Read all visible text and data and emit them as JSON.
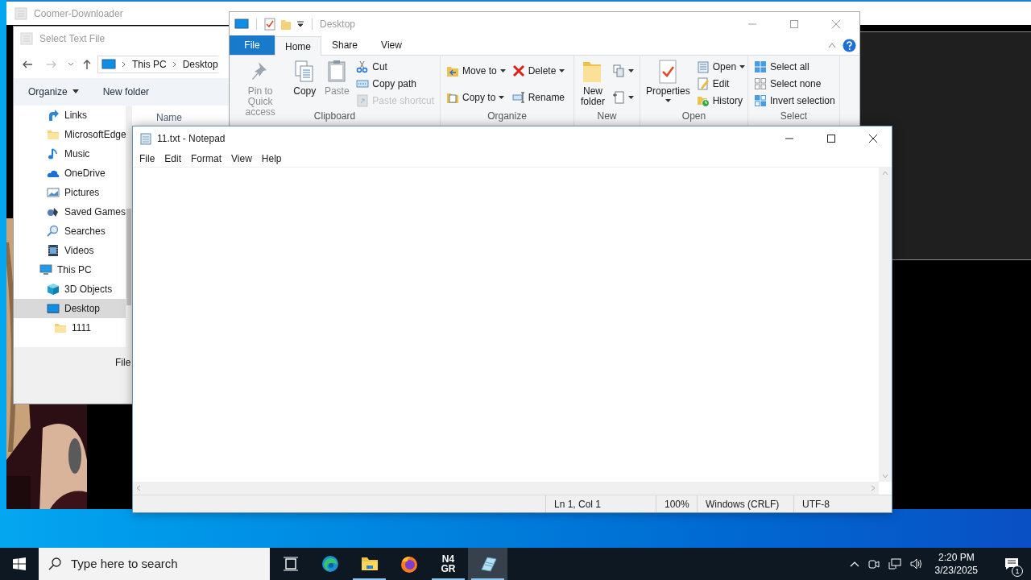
{
  "background_window": {
    "title": "Coomer-Downloader"
  },
  "file_dialog": {
    "title": "Select Text File",
    "breadcrumb": [
      "This PC",
      "Desktop"
    ],
    "toolbar": [
      {
        "label": "Organize",
        "dropdown": true
      },
      {
        "label": "New folder",
        "dropdown": false
      }
    ],
    "tree": [
      {
        "children": [
          {
            "label": "Links",
            "kind": "link",
            "selected": false
          },
          {
            "label": "MicrosoftEdge",
            "kind": "folder",
            "selected": false
          },
          {
            "label": "Music",
            "kind": "music",
            "selected": false
          },
          {
            "label": "OneDrive",
            "kind": "cloud",
            "selected": false
          },
          {
            "label": "Pictures",
            "kind": "pictures",
            "selected": false
          },
          {
            "label": "Saved Games",
            "kind": "games",
            "selected": false
          },
          {
            "label": "Searches",
            "kind": "search",
            "selected": false
          },
          {
            "label": "Videos",
            "kind": "videos",
            "selected": false
          }
        ]
      },
      {
        "label": "This PC",
        "kind": "pc",
        "selected": false,
        "children": [
          {
            "label": "3D Objects",
            "kind": "cube",
            "selected": false
          },
          {
            "label": "Desktop",
            "kind": "desktop",
            "selected": true,
            "children": [
              {
                "label": "1111",
                "kind": "folder",
                "selected": false
              }
            ]
          }
        ]
      }
    ],
    "column": "Name",
    "file_label": "File"
  },
  "explorer": {
    "title": "Desktop",
    "tabs": [
      {
        "label": "File",
        "kind": "backstage",
        "selected": false
      },
      {
        "label": "Home",
        "kind": "tab",
        "selected": true
      },
      {
        "label": "Share",
        "kind": "tab",
        "selected": false
      },
      {
        "label": "View",
        "kind": "tab",
        "selected": false
      }
    ],
    "groups": [
      {
        "label": "Clipboard",
        "columns": [
          [
            {
              "label": "Pin to Quick access",
              "kind": "pin",
              "disabled": true,
              "dropdown": false
            }
          ],
          [
            {
              "label": "Copy",
              "kind": "copy",
              "disabled": false,
              "dropdown": false
            }
          ],
          [
            {
              "label": "Paste",
              "kind": "paste",
              "disabled": true,
              "dropdown": false
            }
          ],
          [
            {
              "label": "Cut",
              "kind": "cut",
              "disabled": false,
              "dropdown": false
            },
            {
              "label": "Copy path",
              "kind": "path",
              "disabled": false,
              "dropdown": false
            },
            {
              "label": "Paste shortcut",
              "kind": "shortcut",
              "disabled": true,
              "dropdown": false
            }
          ]
        ]
      },
      {
        "label": "Organize",
        "columns": [
          [
            {
              "label": "Move to",
              "kind": "move",
              "disabled": false,
              "dropdown": true
            },
            {
              "label": "Copy to",
              "kind": "copyto",
              "disabled": false,
              "dropdown": true
            }
          ],
          [
            {
              "label": "Delete",
              "kind": "delete",
              "disabled": false,
              "dropdown": true
            },
            {
              "label": "Rename",
              "kind": "rename",
              "disabled": false,
              "dropdown": false
            }
          ]
        ]
      },
      {
        "label": "New",
        "columns": [
          [
            {
              "label": "New folder",
              "kind": "newfolder",
              "disabled": false,
              "dropdown": false
            }
          ],
          [
            {
              "kind": "newitem",
              "disabled": false,
              "dropdown": true
            },
            {
              "kind": "easyaccess",
              "disabled": false,
              "dropdown": true
            }
          ]
        ]
      },
      {
        "label": "Open",
        "columns": [
          [
            {
              "label": "Properties",
              "kind": "properties",
              "disabled": false,
              "dropdown": true
            }
          ],
          [
            {
              "label": "Open",
              "kind": "open",
              "disabled": false,
              "dropdown": true
            },
            {
              "label": "Edit",
              "kind": "edit",
              "disabled": false,
              "dropdown": false
            },
            {
              "label": "History",
              "kind": "history",
              "disabled": false,
              "dropdown": false
            }
          ]
        ]
      },
      {
        "label": "Select",
        "columns": [
          [
            {
              "label": "Select all",
              "kind": "selectall",
              "disabled": false,
              "dropdown": false
            },
            {
              "label": "Select none",
              "kind": "selectnone",
              "disabled": false,
              "dropdown": false
            },
            {
              "label": "Invert selection",
              "kind": "invert",
              "disabled": false,
              "dropdown": false
            }
          ]
        ]
      }
    ]
  },
  "notepad": {
    "title": "11.txt - Notepad",
    "menu": [
      "File",
      "Edit",
      "Format",
      "View",
      "Help"
    ],
    "status": [
      "Ln 1, Col 1",
      "100%",
      "Windows (CRLF)",
      "UTF-8"
    ]
  },
  "taskbar": {
    "search_placeholder": "Type here to search",
    "apps": [
      {
        "kind": "taskview",
        "running": false,
        "selected": false
      },
      {
        "kind": "edge",
        "running": false,
        "selected": false
      },
      {
        "kind": "explorer",
        "running": true,
        "selected": false
      },
      {
        "kind": "firefox",
        "running": false,
        "selected": false
      },
      {
        "kind": "n4gr",
        "text": "N4GR",
        "running": true,
        "selected": false
      },
      {
        "kind": "notepad",
        "running": true,
        "selected": true
      }
    ],
    "time": "2:20 PM",
    "date": "3/23/2025",
    "notifications": "1"
  }
}
